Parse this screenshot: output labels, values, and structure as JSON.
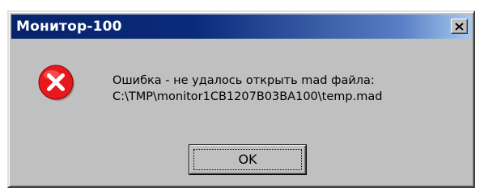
{
  "window": {
    "title": "Монитор-100",
    "close_icon": "close-x-icon"
  },
  "message": {
    "icon": "error-icon",
    "line1": "Ошибка - не удалось открыть mad файла:",
    "line2": "C:\\TMP\\monitor1CB1207B03BA100\\temp.mad"
  },
  "buttons": {
    "ok_label": "OK"
  },
  "colors": {
    "titlebar_start": "#08246b",
    "titlebar_end": "#a6caf0",
    "face": "#c0c0c0",
    "error_red": "#e8181c"
  }
}
